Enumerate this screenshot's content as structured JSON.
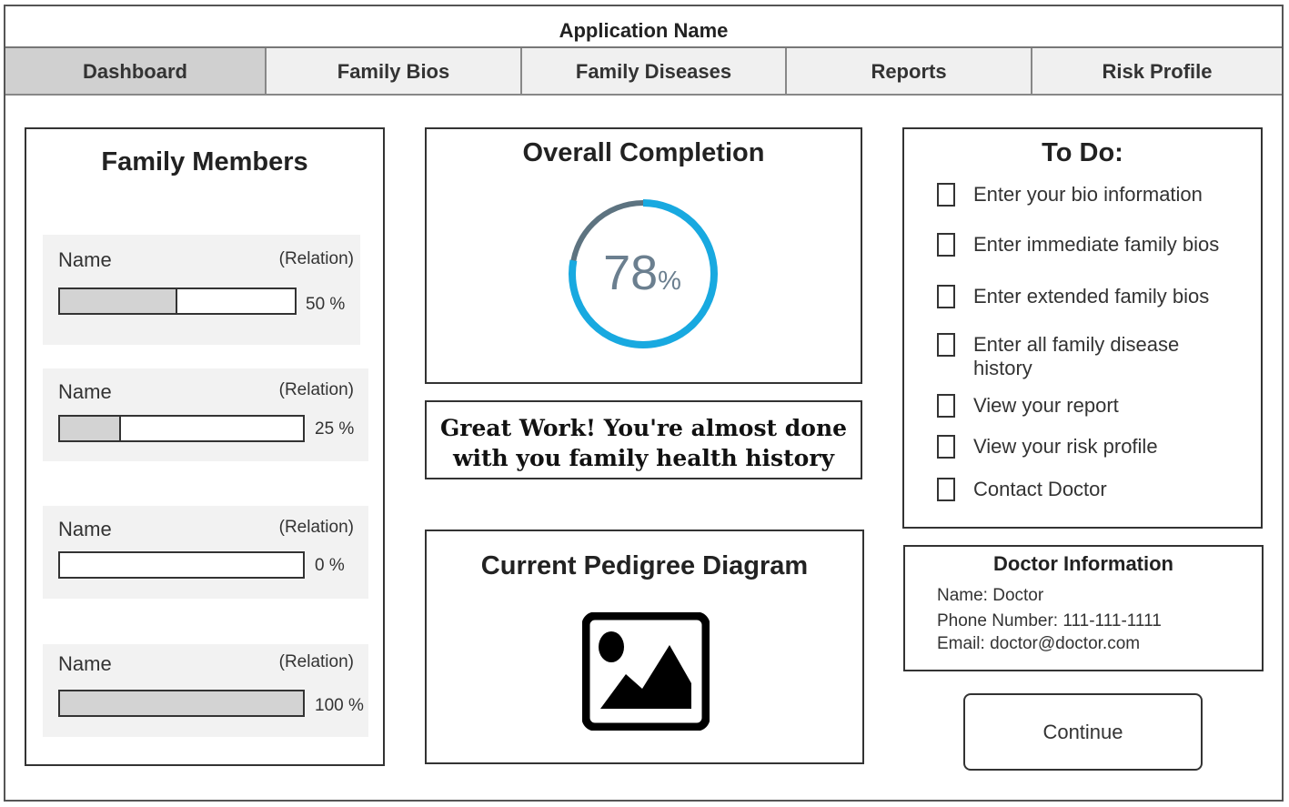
{
  "app": {
    "title": "Application Name"
  },
  "tabs": [
    {
      "label": "Dashboard",
      "active": true
    },
    {
      "label": "Family Bios"
    },
    {
      "label": "Family Diseases"
    },
    {
      "label": "Reports"
    },
    {
      "label": "Risk Profile"
    }
  ],
  "family": {
    "title": "Family Members",
    "members": [
      {
        "name": "Name",
        "relation": "(Relation)",
        "progress": 0.5,
        "percent_label": "50 %"
      },
      {
        "name": "Name",
        "relation": "(Relation)",
        "progress": 0.25,
        "percent_label": "25 %"
      },
      {
        "name": "Name",
        "relation": "(Relation)",
        "progress": 0,
        "percent_label": "0 %"
      },
      {
        "name": "Name",
        "relation": "(Relation)",
        "progress": 1,
        "percent_label": "100 %"
      }
    ]
  },
  "completion": {
    "title": "Overall Completion",
    "value": "78",
    "unit": "%",
    "fraction": 0.78,
    "ring_color": "#18a9e0",
    "track_color": "#5d7380"
  },
  "message": {
    "line1": "Great Work! You're almost done",
    "line2": "with you family health history"
  },
  "pedigree": {
    "title": "Current Pedigree Diagram",
    "icon": "image-placeholder-icon"
  },
  "todo": {
    "title": "To Do:",
    "items": [
      "Enter your bio information",
      "Enter immediate family bios",
      "Enter extended family bios",
      "Enter all family disease history",
      "View your report",
      "View your risk profile",
      "Contact Doctor"
    ]
  },
  "doctor": {
    "title": "Doctor Information",
    "name": "Name: Doctor",
    "phone": "Phone Number: 111-111-1111",
    "email": "Email: doctor@doctor.com"
  },
  "continue_label": "Continue"
}
